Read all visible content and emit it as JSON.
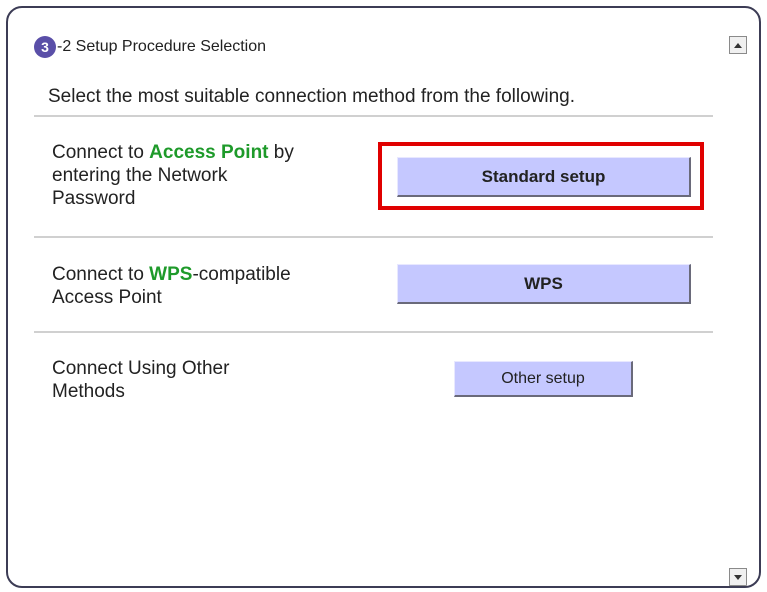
{
  "header": {
    "step_number": "3",
    "title": "-2 Setup Procedure Selection"
  },
  "instruction": "Select the most suitable connection method from the following.",
  "options": [
    {
      "text_before": "Connect to ",
      "highlight": "Access Point",
      "text_after_line1": " by",
      "text_line2": "entering the Network",
      "text_line3": "Password",
      "button_label": "Standard setup"
    },
    {
      "text_before": "Connect to ",
      "highlight": "WPS",
      "text_after_line1": "-compatible",
      "text_line2": "Access Point",
      "button_label": "WPS"
    },
    {
      "text_line1": "Connect Using Other",
      "text_line2": "Methods",
      "button_label": "Other setup"
    }
  ],
  "colors": {
    "highlight_green": "#1e9a2a",
    "button_fill": "#c5c8ff",
    "selection_border": "#e00000",
    "step_badge": "#5a4fa8"
  },
  "icons": {
    "scroll_up": "triangle-up-icon",
    "scroll_down": "triangle-down-icon"
  }
}
